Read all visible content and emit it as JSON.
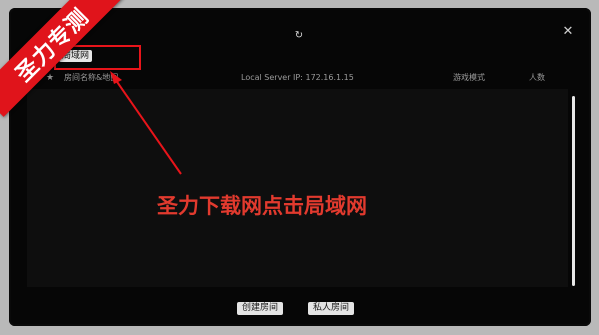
{
  "watermark": {
    "text": "圣力专测",
    "color": "#e0141b"
  },
  "toolbar": {
    "refresh_icon": "refresh-icon",
    "close_icon": "close-icon"
  },
  "tabs": {
    "lan_label": "局域网"
  },
  "columns": {
    "favorite_icon": "star-icon",
    "name_label": "房间名称&地图",
    "server_ip": "Local Server IP: 172.16.1.15",
    "mode_label": "游戏模式",
    "count_label": "人数"
  },
  "room_list": [],
  "annotation": {
    "text": "圣力下载网点击局域网",
    "color": "#e23a2e"
  },
  "buttons": {
    "create_room": "创建房间",
    "private_room": "私人房间"
  }
}
